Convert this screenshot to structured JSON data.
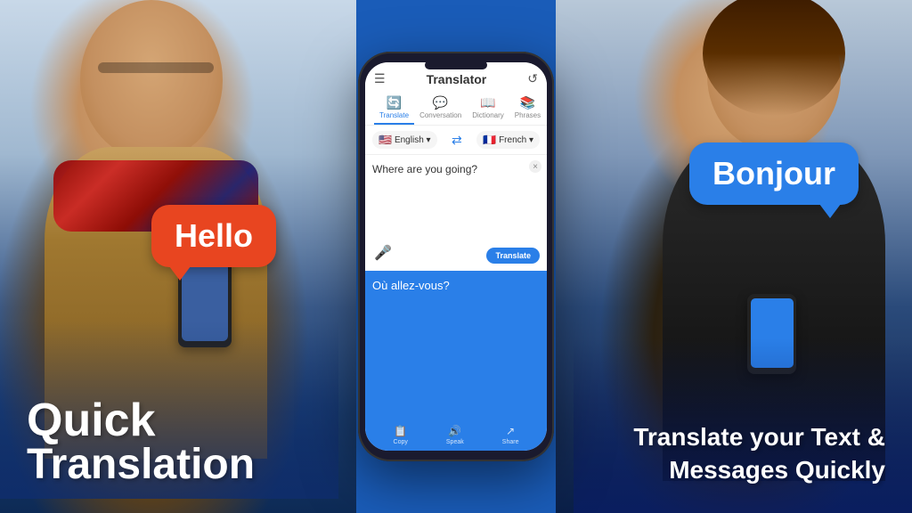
{
  "app": {
    "title": "Translator",
    "hamburger": "☰",
    "history_icon": "↺"
  },
  "tabs": [
    {
      "icon": "🔄",
      "label": "Translate",
      "active": true
    },
    {
      "icon": "💬",
      "label": "Conversation",
      "active": false
    },
    {
      "icon": "📖",
      "label": "Dictionary",
      "active": false
    },
    {
      "icon": "📚",
      "label": "Phrases",
      "active": false
    }
  ],
  "language_selector": {
    "source_flag": "🇺🇸",
    "source_lang": "English ▾",
    "swap_icon": "⇄",
    "target_flag": "🇫🇷",
    "target_lang": "French ▾"
  },
  "input": {
    "text": "Where are you going?",
    "close": "×",
    "mic_icon": "🎤",
    "translate_btn": "Translate"
  },
  "output": {
    "text": "Où allez-vous?",
    "actions": [
      {
        "icon": "📋",
        "label": "Copy"
      },
      {
        "icon": "🔊",
        "label": "Speak"
      },
      {
        "icon": "↗",
        "label": "Share"
      }
    ]
  },
  "left_bubble": {
    "text": "Hello"
  },
  "right_bubble": {
    "text": "Bonjour"
  },
  "left_caption": {
    "line1": "Quick",
    "line2": "Translation"
  },
  "right_caption": {
    "text": "Translate your Text &\nMessages Quickly"
  }
}
